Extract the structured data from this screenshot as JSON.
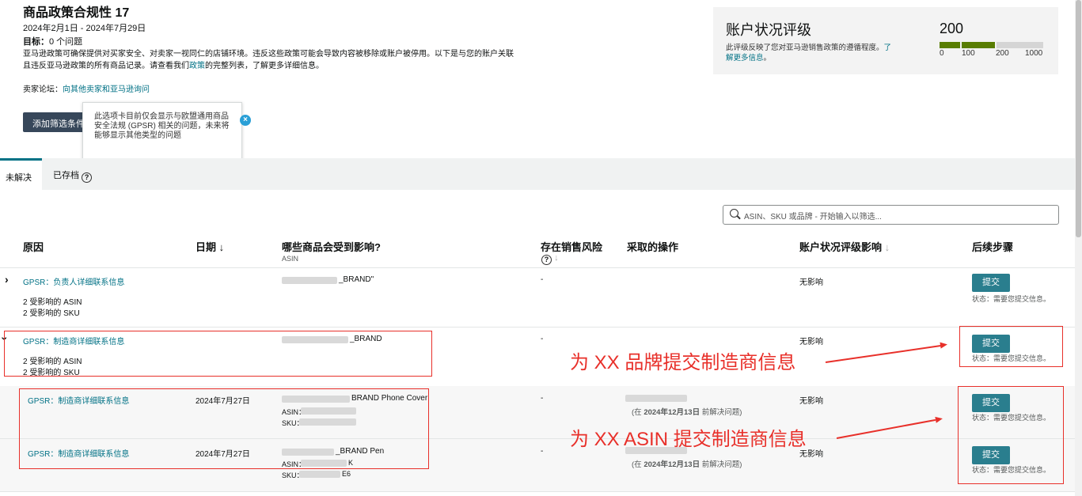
{
  "page": {
    "title": "商品政策合规性 17",
    "date_range": "2024年2月1日 - 2024年7月29日",
    "target_label": "目标：",
    "target_value": "0 个问题",
    "description_1": "亚马逊政策可确保提供对买家安全、对卖家一视同仁的店铺环境。违反这些政策可能会导致内容被移除或账户被停用。以下是与您的账户关联",
    "description_2": "且违反亚马逊政策的所有商品记录。请查看我们",
    "description_link": "政策",
    "description_3": "的完整列表，了解更多详细信息。",
    "forum_label": "卖家论坛：",
    "forum_link": "向其他卖家和亚马逊询问",
    "filter_button": "添加筛选条件",
    "tooltip": "此选项卡目前仅会显示与欧盟通用商品安全法规 (GPSR) 相关的问题，未来将能够显示其他类型的问题"
  },
  "rating": {
    "title": "账户状况评级",
    "desc_1": "此评级反映了您对亚马逊销售政策的遵循程度。",
    "desc_link": "了解更多信息",
    "desc_end": "。",
    "score": "200",
    "ticks": [
      "0",
      "100",
      "200",
      "1000"
    ],
    "bar_colors": {
      "filled": "#597d03",
      "empty": "#d5d5d5"
    }
  },
  "tabs": {
    "unresolved": "未解决",
    "archived": "已存档",
    "help_icon_glyph": "?"
  },
  "search": {
    "placeholder": "ASIN、SKU 或品牌 - 开始输入以筛选..."
  },
  "table": {
    "headers": {
      "reason": "原因",
      "date": "日期 ↓",
      "affected": "哪些商品会受到影响?",
      "affected_sub": "ASIN",
      "risk": "存在销售风险",
      "risk_sort": "↓",
      "action": "采取的操作",
      "impact": "账户状况评级影响",
      "impact_sort": "↓",
      "next": "后续步骤"
    },
    "rows": [
      {
        "reason": "GPSR：负责人详细联系信息",
        "affected": "_BRAND\"",
        "count_asin": "2 受影响的 ASIN",
        "count_sku": "2 受影响的 SKU",
        "risk": "-",
        "impact": "无影响",
        "button": "提交",
        "status": "状态：需要您提交信息。"
      },
      {
        "reason": "GPSR：制造商详细联系信息",
        "affected": "_BRAND",
        "count_asin": "2 受影响的 ASIN",
        "count_sku": "2 受影响的 SKU",
        "risk": "-",
        "impact": "无影响",
        "button": "提交",
        "status": "状态：需要您提交信息。"
      },
      {
        "reason": "GPSR：制造商详细联系信息",
        "date": "2024年7月27日",
        "affected": "BRAND Phone Cover",
        "asin_label": "ASIN：",
        "sku_label": "SKU：",
        "risk": "-",
        "action_before": "(在 ",
        "action_date": "2024年12月13日",
        "action_after": " 前解决问题)",
        "impact": "无影响",
        "button": "提交",
        "status": "状态：需要您提交信息。"
      },
      {
        "reason": "GPSR：制造商详细联系信息",
        "date": "2024年7月27日",
        "affected": "_BRAND Pen",
        "asin_label": "ASIN：",
        "asin_tail": "K",
        "sku_label": "SKU：",
        "sku_tail": "E6",
        "risk": "-",
        "action_before": "(在 ",
        "action_date": "2024年12月13日",
        "action_after": " 前解决问题)",
        "impact": "无影响",
        "button": "提交",
        "status": "状态：需要您提交信息。"
      }
    ]
  },
  "annotations": {
    "brand": "为 XX 品牌提交制造商信息",
    "asin": "为 XX ASIN 提交制造商信息",
    "color": "#e8302a"
  },
  "colors": {
    "link": "#007185",
    "button": "#2a7e8e",
    "dark_button": "#37475a"
  }
}
